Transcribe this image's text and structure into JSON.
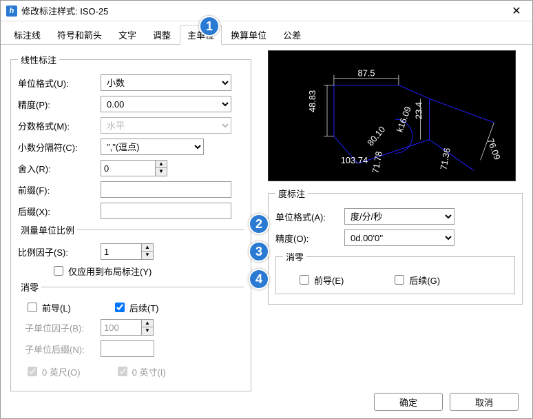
{
  "window": {
    "title": "修改标注样式: ISO-25",
    "close": "✕"
  },
  "tabs": {
    "items": [
      "标注线",
      "符号和箭头",
      "文字",
      "调整",
      "主单位",
      "换算单位",
      "公差"
    ],
    "active_index": 4
  },
  "linear": {
    "legend": "线性标注",
    "unit_format_label": "单位格式(U):",
    "unit_format_value": "小数",
    "precision_label": "精度(P):",
    "precision_value": "0.00",
    "fraction_format_label": "分数格式(M):",
    "fraction_format_value": "水平",
    "decimal_sep_label": "小数分隔符(C):",
    "decimal_sep_value": "\",\"(逗点)",
    "round_label": "舍入(R):",
    "round_value": "0",
    "prefix_label": "前缀(F):",
    "prefix_value": "",
    "suffix_label": "后缀(X):",
    "suffix_value": "",
    "scale_legend": "测量单位比例",
    "scale_factor_label": "比例因子(S):",
    "scale_factor_value": "1",
    "scale_layout_only": "仅应用到布局标注(Y)",
    "zero_legend": "消零",
    "leading": "前导(L)",
    "trailing": "后续(T)",
    "trailing_checked": true,
    "subunit_factor_label": "子单位因子(B):",
    "subunit_factor_value": "100",
    "subunit_suffix_label": "子单位后缀(N):",
    "subunit_suffix_value": "",
    "zero_feet": "0 英尺(O)",
    "zero_inch": "0 英寸(I)"
  },
  "angular": {
    "legend": "度标注",
    "unit_format_label": "单位格式(A):",
    "unit_format_value": "度/分/秒",
    "precision_label": "精度(O):",
    "precision_value": "0d.00'0''",
    "zero_legend": "消零",
    "leading": "前导(E)",
    "trailing": "后续(G)"
  },
  "preview": {
    "dims": [
      "87.5",
      "48.83",
      "103.74",
      "80.10",
      "k16.09",
      "76.09",
      "23.4",
      "71.78",
      "71.36"
    ]
  },
  "footer": {
    "ok": "确定",
    "cancel": "取消"
  },
  "callouts": [
    "1",
    "2",
    "3",
    "4"
  ]
}
